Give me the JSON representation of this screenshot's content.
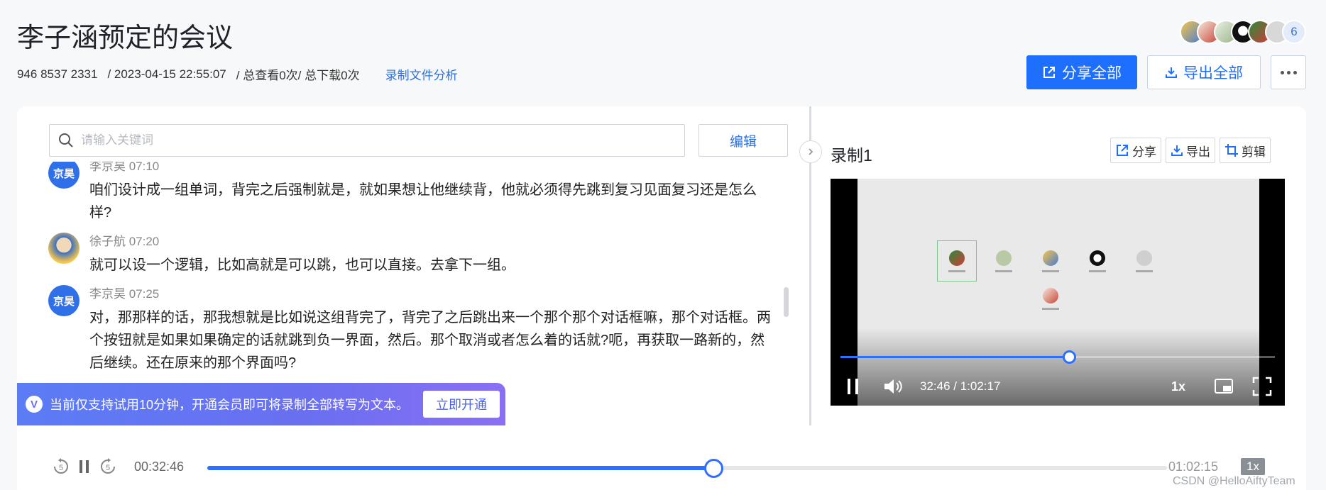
{
  "header": {
    "title": "李子涵预定的会议",
    "meeting_id": "946 8537 2331",
    "datetime": "/ 2023-04-15 22:55:07",
    "stats": "/ 总查看0次/ 总下载0次",
    "analysis_link": "录制文件分析",
    "participant_count": "6",
    "share_all": "分享全部",
    "export_all": "导出全部"
  },
  "search": {
    "placeholder": "请输入关键词",
    "edit_label": "编辑"
  },
  "transcript": [
    {
      "speaker": "李京昊 07:10",
      "avatar_text": "京昊",
      "text": "咱们设计成一组单词，背完之后强制就是，就如果想让他继续背，他就必须得先跳到复习见面复习还是怎么样?"
    },
    {
      "speaker": "徐子航 07:20",
      "avatar_text": "",
      "text": "就可以设一个逻辑，比如高就是可以跳，也可以直接。去拿下一组。"
    },
    {
      "speaker": "李京昊 07:25",
      "avatar_text": "京昊",
      "text": "对，那那样的话，那我想就是比如说这组背完了，背完了之后跳出来一个那个那个对话框嘛，那个对话框。两个按钮就是如果如果确定的话就跳到负一界面，然后。那个取消或者怎么着的话就?呃，再获取一路新的，然后继续。还在原来的那个界面吗?"
    }
  ],
  "trial_banner": {
    "badge": "V",
    "message": "当前仅支持试用10分钟，开通会员即可将录制全部转写为文本。",
    "button": "立即开通"
  },
  "recording": {
    "title": "录制1",
    "share": "分享",
    "export": "导出",
    "clip": "剪辑",
    "time": "32:46 / 1:02:17",
    "rate": "1x",
    "progress": 0.527
  },
  "player": {
    "current": "00:32:46",
    "total": "01:02:15",
    "rate": "1x",
    "progress": 0.527
  },
  "watermark": "CSDN @HelloAiftyTeam",
  "colors": {
    "accent": "#1f6fff",
    "link": "#2f6fdb",
    "banner": "#6a6ff0"
  }
}
